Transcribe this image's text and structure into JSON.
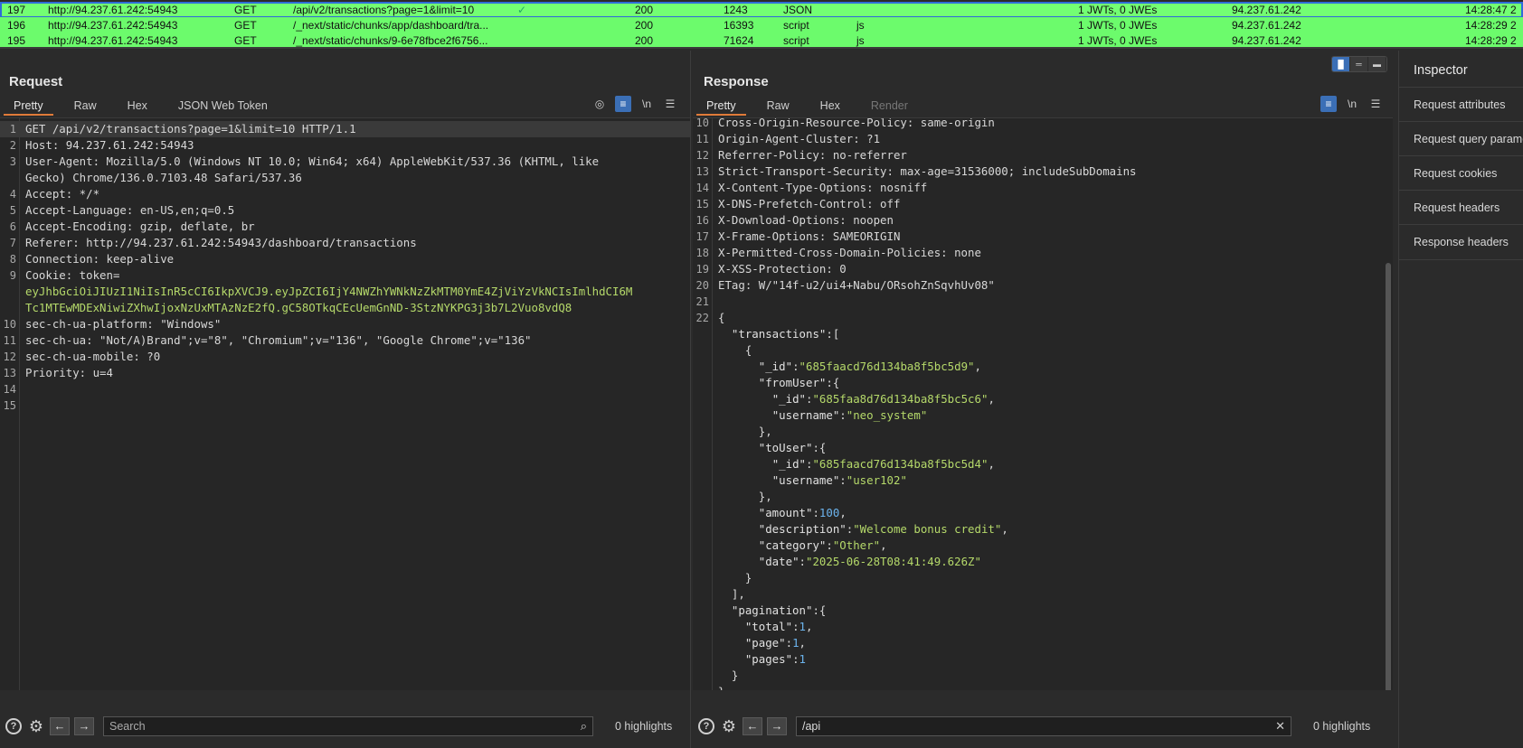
{
  "history": [
    {
      "num": "197",
      "host": "http://94.237.61.242:54943",
      "method": "GET",
      "url": "/api/v2/transactions?page=1&limit=10",
      "check": "✓",
      "status": "200",
      "length": "1243",
      "mime": "JSON",
      "ext": "",
      "jwt": "1 JWTs, 0 JWEs",
      "ip": "94.237.61.242",
      "time": "14:28:47 2"
    },
    {
      "num": "196",
      "host": "http://94.237.61.242:54943",
      "method": "GET",
      "url": "/_next/static/chunks/app/dashboard/tra...",
      "check": "",
      "status": "200",
      "length": "16393",
      "mime": "script",
      "ext": "js",
      "jwt": "1 JWTs, 0 JWEs",
      "ip": "94.237.61.242",
      "time": "14:28:29 2"
    },
    {
      "num": "195",
      "host": "http://94.237.61.242:54943",
      "method": "GET",
      "url": "/_next/static/chunks/9-6e78fbce2f6756...",
      "check": "",
      "status": "200",
      "length": "71624",
      "mime": "script",
      "ext": "js",
      "jwt": "1 JWTs, 0 JWEs",
      "ip": "94.237.61.242",
      "time": "14:28:29 2"
    }
  ],
  "request": {
    "title": "Request",
    "tabs": [
      "Pretty",
      "Raw",
      "Hex",
      "JSON Web Token"
    ],
    "lines": [
      {
        "n": "1",
        "text": "GET /api/v2/transactions?page=1&limit=10 HTTP/1.1"
      },
      {
        "n": "2",
        "text": "Host: 94.237.61.242:54943"
      },
      {
        "n": "3",
        "text": "User-Agent: Mozilla/5.0 (Windows NT 10.0; Win64; x64) AppleWebKit/537.36 (KHTML, like"
      },
      {
        "n": "",
        "text": "Gecko) Chrome/136.0.7103.48 Safari/537.36"
      },
      {
        "n": "4",
        "text": "Accept: */*"
      },
      {
        "n": "5",
        "text": "Accept-Language: en-US,en;q=0.5"
      },
      {
        "n": "6",
        "text": "Accept-Encoding: gzip, deflate, br"
      },
      {
        "n": "7",
        "text": "Referer: http://94.237.61.242:54943/dashboard/transactions"
      },
      {
        "n": "8",
        "text": "Connection: keep-alive"
      },
      {
        "n": "9",
        "text": "Cookie: token="
      },
      {
        "n": "",
        "text": "eyJhbGciOiJIUzI1NiIsInR5cCI6IkpXVCJ9.eyJpZCI6IjY4NWZhYWNkNzZkMTM0YmE4ZjViYzVkNCIsImlhdCI6M",
        "token": true
      },
      {
        "n": "",
        "text": "Tc1MTEwMDExNiwiZXhwIjoxNzUxMTAzNzE2fQ.gC58OTkqCEcUemGnND-3StzNYKPG3j3b7L2Vuo8vdQ8",
        "token": true
      },
      {
        "n": "10",
        "text": "sec-ch-ua-platform: \"Windows\""
      },
      {
        "n": "11",
        "text": "sec-ch-ua: \"Not/A)Brand\";v=\"8\", \"Chromium\";v=\"136\", \"Google Chrome\";v=\"136\""
      },
      {
        "n": "12",
        "text": "sec-ch-ua-mobile: ?0"
      },
      {
        "n": "13",
        "text": "Priority: u=4"
      },
      {
        "n": "14",
        "text": ""
      },
      {
        "n": "15",
        "text": ""
      }
    ],
    "search_placeholder": "Search",
    "highlights": "0 highlights"
  },
  "response": {
    "title": "Response",
    "tabs": [
      "Pretty",
      "Raw",
      "Hex",
      "Render"
    ],
    "lines": [
      {
        "n": "10",
        "text": "Cross-Origin-Resource-Policy: same-origin"
      },
      {
        "n": "11",
        "text": "Origin-Agent-Cluster: ?1"
      },
      {
        "n": "12",
        "text": "Referrer-Policy: no-referrer"
      },
      {
        "n": "13",
        "text": "Strict-Transport-Security: max-age=31536000; includeSubDomains"
      },
      {
        "n": "14",
        "text": "X-Content-Type-Options: nosniff"
      },
      {
        "n": "15",
        "text": "X-DNS-Prefetch-Control: off"
      },
      {
        "n": "16",
        "text": "X-Download-Options: noopen"
      },
      {
        "n": "17",
        "text": "X-Frame-Options: SAMEORIGIN"
      },
      {
        "n": "18",
        "text": "X-Permitted-Cross-Domain-Policies: none"
      },
      {
        "n": "19",
        "text": "X-XSS-Protection: 0"
      },
      {
        "n": "20",
        "text": "ETag: W/\"14f-u2/ui4+Nabu/ORsohZnSqvhUv08\""
      },
      {
        "n": "21",
        "text": ""
      },
      {
        "n": "22",
        "text": "{"
      },
      {
        "n": "",
        "text": "  \"transactions\":[",
        "json": true
      },
      {
        "n": "",
        "text": "    {"
      },
      {
        "n": "",
        "text": "      \"_id\":\"685faacd76d134ba8f5bc5d9\",",
        "json": true
      },
      {
        "n": "",
        "text": "      \"fromUser\":{",
        "json": true
      },
      {
        "n": "",
        "text": "        \"_id\":\"685faa8d76d134ba8f5bc5c6\",",
        "json": true
      },
      {
        "n": "",
        "text": "        \"username\":\"neo_system\"",
        "json": true
      },
      {
        "n": "",
        "text": "      },"
      },
      {
        "n": "",
        "text": "      \"toUser\":{",
        "json": true
      },
      {
        "n": "",
        "text": "        \"_id\":\"685faacd76d134ba8f5bc5d4\",",
        "json": true
      },
      {
        "n": "",
        "text": "        \"username\":\"user102\"",
        "json": true
      },
      {
        "n": "",
        "text": "      },"
      },
      {
        "n": "",
        "text": "      \"amount\":100,",
        "json": true
      },
      {
        "n": "",
        "text": "      \"description\":\"Welcome bonus credit\",",
        "json": true
      },
      {
        "n": "",
        "text": "      \"category\":\"Other\",",
        "json": true
      },
      {
        "n": "",
        "text": "      \"date\":\"2025-06-28T08:41:49.626Z\"",
        "json": true
      },
      {
        "n": "",
        "text": "    }"
      },
      {
        "n": "",
        "text": "  ],"
      },
      {
        "n": "",
        "text": "  \"pagination\":{",
        "json": true
      },
      {
        "n": "",
        "text": "    \"total\":1,",
        "json": true
      },
      {
        "n": "",
        "text": "    \"page\":1,",
        "json": true
      },
      {
        "n": "",
        "text": "    \"pages\":1",
        "json": true
      },
      {
        "n": "",
        "text": "  }"
      },
      {
        "n": "",
        "text": "}"
      }
    ],
    "search_value": "/api",
    "highlights": "0 highlights"
  },
  "inspector": {
    "title": "Inspector",
    "sections": [
      "Request attributes",
      "Request query parameters",
      "Request cookies",
      "Request headers",
      "Response headers"
    ]
  },
  "icons": {
    "help": "help-circle-icon",
    "settings": "gear-icon",
    "back": "arrow-left-icon",
    "forward": "arrow-right-icon"
  }
}
